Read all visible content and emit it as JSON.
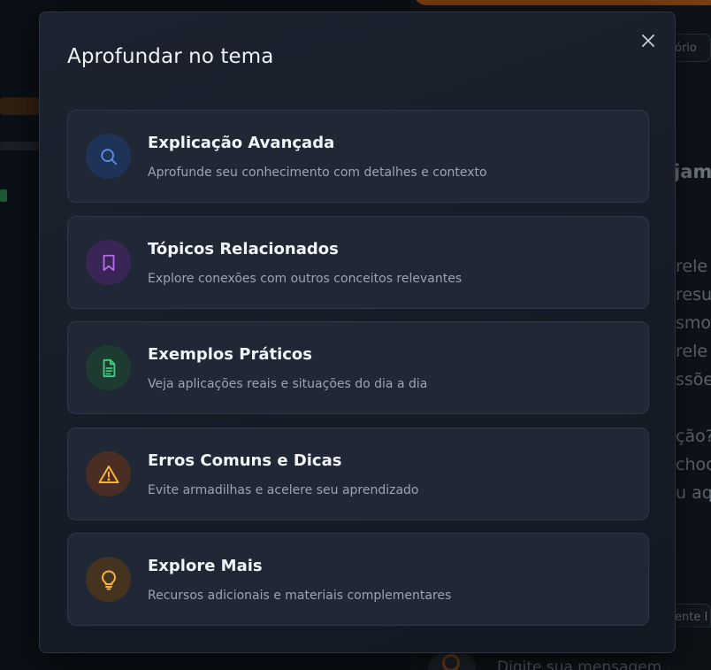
{
  "modal": {
    "title": "Aprofundar no tema",
    "close_icon": "close-icon",
    "options": [
      {
        "title": "Explicação Avançada",
        "description": "Aprofunde seu conhecimento com detalhes e contexto",
        "icon": "search-icon",
        "icon_color": "#5b8def",
        "icon_bg": "#1f3358"
      },
      {
        "title": "Tópicos Relacionados",
        "description": "Explore conexões com outros conceitos relevantes",
        "icon": "bookmark-icon",
        "icon_color": "#b66bef",
        "icon_bg": "#3a2656"
      },
      {
        "title": "Exemplos Práticos",
        "description": "Veja aplicações reais e situações do dia a dia",
        "icon": "document-icon",
        "icon_color": "#3fcf7d",
        "icon_bg": "#1d3b30"
      },
      {
        "title": "Erros Comuns e Dicas",
        "description": "Evite armadilhas e acelere seu aprendizado",
        "icon": "warning-icon",
        "icon_color": "#f2b43a",
        "icon_bg": "#4a2e24"
      },
      {
        "title": "Explore Mais",
        "description": "Recursos adicionais e materiais complementares",
        "icon": "lightbulb-icon",
        "icon_color": "#f2b43a",
        "icon_bg": "#45321f"
      }
    ]
  },
  "background": {
    "header_pill": "ório",
    "heading_fragment": "jam",
    "text_lines": [
      "rele",
      "resul",
      "smo,",
      "rele",
      "ssões",
      "ção?",
      "chool",
      "u aqu"
    ],
    "footer_pill": "ente I",
    "message_placeholder": "Digite sua mensagem..."
  }
}
